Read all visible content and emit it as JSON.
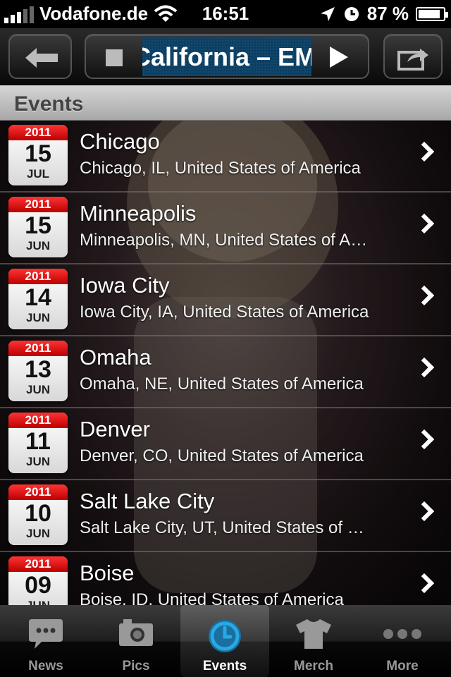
{
  "status_bar": {
    "carrier": "Vodafone.de",
    "time": "16:51",
    "battery_percent": "87 %",
    "battery_level": 0.87
  },
  "toolbar": {
    "now_playing": "California – EMA"
  },
  "section": {
    "title": "Events"
  },
  "events": [
    {
      "year": "2011",
      "day": "15",
      "month": "JUL",
      "city": "Chicago",
      "location": "Chicago, IL, United States of America"
    },
    {
      "year": "2011",
      "day": "15",
      "month": "JUN",
      "city": "Minneapolis",
      "location": "Minneapolis, MN, United States of A…"
    },
    {
      "year": "2011",
      "day": "14",
      "month": "JUN",
      "city": "Iowa City",
      "location": "Iowa City, IA, United States of America"
    },
    {
      "year": "2011",
      "day": "13",
      "month": "JUN",
      "city": "Omaha",
      "location": "Omaha, NE, United States of America"
    },
    {
      "year": "2011",
      "day": "11",
      "month": "JUN",
      "city": "Denver",
      "location": "Denver, CO, United States of America"
    },
    {
      "year": "2011",
      "day": "10",
      "month": "JUN",
      "city": "Salt Lake City",
      "location": "Salt Lake City, UT, United States of …"
    },
    {
      "year": "2011",
      "day": "09",
      "month": "JUN",
      "city": "Boise",
      "location": "Boise, ID, United States of America"
    }
  ],
  "tabs": [
    {
      "label": "News",
      "icon": "speech-bubble-icon"
    },
    {
      "label": "Pics",
      "icon": "camera-icon"
    },
    {
      "label": "Events",
      "icon": "clock-icon"
    },
    {
      "label": "Merch",
      "icon": "tshirt-icon"
    },
    {
      "label": "More",
      "icon": "more-dots-icon"
    }
  ],
  "colors": {
    "calendar_red": "#dd1111",
    "active_tab_icon": "#29a9e1"
  }
}
